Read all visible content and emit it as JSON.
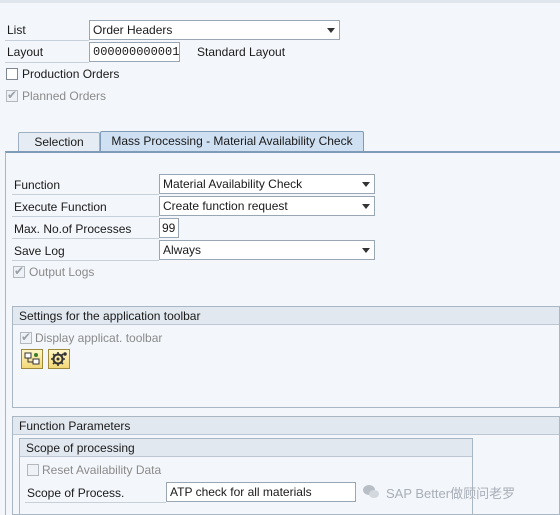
{
  "header": {
    "list_label": "List",
    "list_value": "Order Headers",
    "layout_label": "Layout",
    "layout_value": "000000000001",
    "layout_desc": "Standard Layout",
    "production_orders_label": "Production Orders",
    "planned_orders_label": "Planned Orders"
  },
  "tabs": [
    {
      "label": "Selection"
    },
    {
      "label": "Mass Processing - Material Availability Check"
    }
  ],
  "mass": {
    "function_label": "Function",
    "function_value": "Material Availability Check",
    "execute_label": "Execute Function",
    "execute_value": "Create function request",
    "max_label": "Max. No.of Processes",
    "max_value": "99",
    "savelog_label": "Save Log",
    "savelog_value": "Always",
    "output_logs_label": "Output Logs"
  },
  "toolbar_settings": {
    "title": "Settings for the application toolbar",
    "display_toolbar_label": "Display applicat. toolbar",
    "buttons": [
      {
        "icon": "select-layout-icon"
      },
      {
        "icon": "settings-gear-icon"
      }
    ]
  },
  "function_params": {
    "title": "Function Parameters",
    "scope_title": "Scope of processing",
    "reset_label": "Reset Availability Data",
    "scope_label": "Scope of Process.",
    "scope_value": "ATP check for all materials"
  },
  "watermark": "SAP Better做顾问老罗",
  "colors": {
    "background": "#f3f6fa",
    "tab_active": "#cfe0f2",
    "group_title": "#e2e8ef",
    "button_gold": "#f3d877"
  }
}
